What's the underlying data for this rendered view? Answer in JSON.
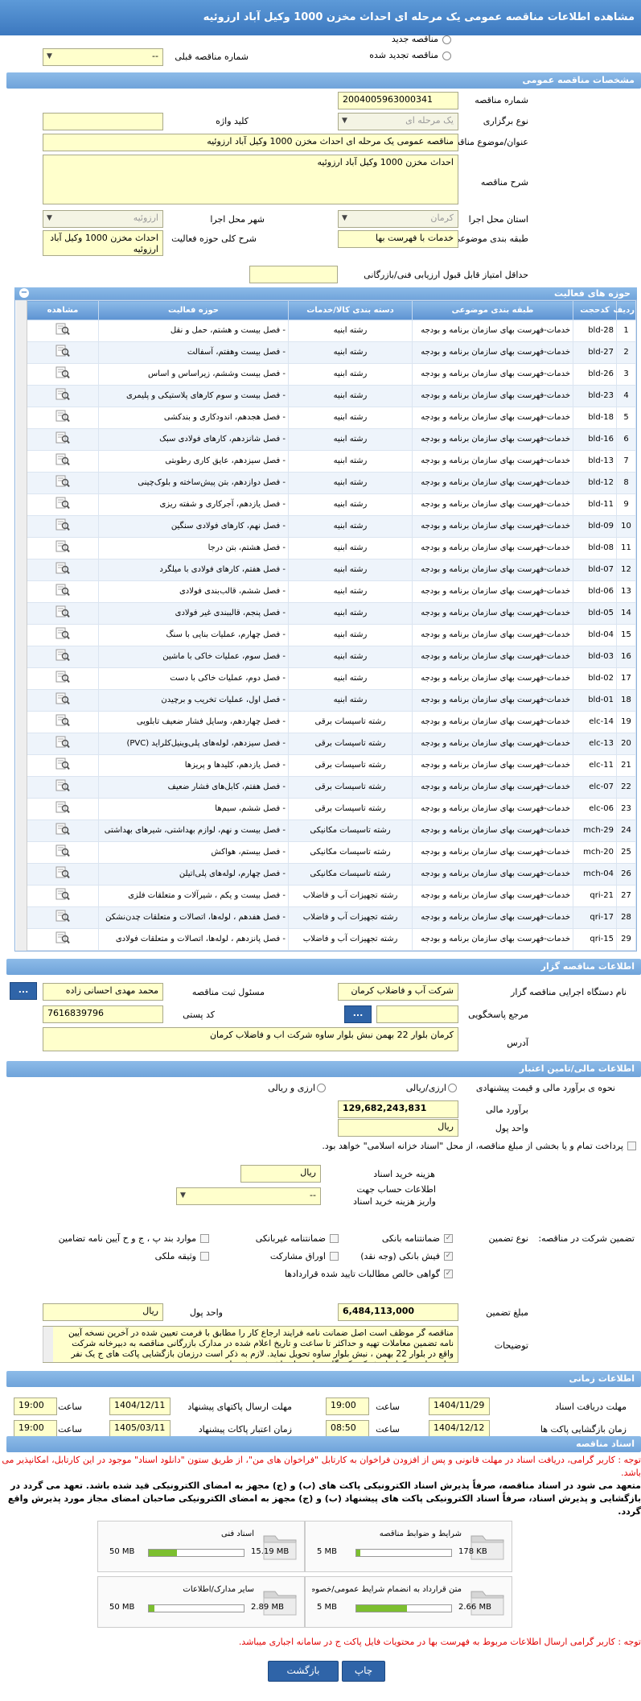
{
  "title": "مشاهده اطلاعات مناقصه عمومی یک مرحله ای احداث مخزن 1000 وکیل آباد ارزوئیه",
  "top": {
    "radio_new": "مناقصه جدید",
    "radio_renewed": "مناقصه تجدید شده",
    "prev_number_label": "شماره مناقصه قبلی",
    "prev_number_value": "--"
  },
  "general": {
    "section": "مشخصات مناقصه عمومی",
    "number_label": "شماره مناقصه",
    "number_value": "2004005963000341",
    "type_label": "نوع برگزاری",
    "type_value": "یک مرحله ای",
    "keyword_label": "کلید واژه",
    "keyword_value": "",
    "subject_label": "عنوان/موضوع مناقصه",
    "subject_value": "مناقصه عمومی یک مرحله ای احداث مخزن 1000 وکیل آباد ارزوئیه",
    "desc_label": "شرح مناقصه",
    "desc_value": "احداث مخزن 1000 وکیل آباد ارزوئیه",
    "province_label": "استان محل اجرا",
    "province_value": "کرمان",
    "city_label": "شهر محل اجرا",
    "city_value": "ارزوئیه",
    "category_label": "طبقه بندی موضوعی",
    "category_value": "خدمات با فهرست بها",
    "scope_label": "شرح کلی حوزه فعالیت",
    "scope_value": "احداث مخزن 1000 وکیل آباد ارزوئیه",
    "min_score_label": "حداقل امتیاز قابل قبول ارزیابی فنی/بازرگانی",
    "min_score_value": ""
  },
  "activities": {
    "section": "حوزه های فعالیت",
    "columns": [
      "ردیف",
      "کدحجت",
      "طبقه بندی موضوعی",
      "دسته بندی کالا/خدمات",
      "حوزه فعالیت",
      "مشاهده"
    ],
    "rows": [
      {
        "n": "1",
        "code": "bld-28",
        "cat": "خدمات-فهرست بهای سازمان برنامه و بودجه",
        "group": "رشته ابنیه",
        "field": "- فصل بیست و هشتم، حمل و نقل"
      },
      {
        "n": "2",
        "code": "bld-27",
        "cat": "خدمات-فهرست بهای سازمان برنامه و بودجه",
        "group": "رشته ابنیه",
        "field": "- فصل بیست وهفتم، آسفالت"
      },
      {
        "n": "3",
        "code": "bld-26",
        "cat": "خدمات-فهرست بهای سازمان برنامه و بودجه",
        "group": "رشته ابنیه",
        "field": "- فصل بیست وششم، زیراساس و اساس"
      },
      {
        "n": "4",
        "code": "bld-23",
        "cat": "خدمات-فهرست بهای سازمان برنامه و بودجه",
        "group": "رشته ابنیه",
        "field": "- فصل بیست و سوم کارهای پلاستیکی و پلیمری"
      },
      {
        "n": "5",
        "code": "bld-18",
        "cat": "خدمات-فهرست بهای سازمان برنامه و بودجه",
        "group": "رشته ابنیه",
        "field": "- فصل هجدهم، اندودکاری و بندکشی"
      },
      {
        "n": "6",
        "code": "bld-16",
        "cat": "خدمات-فهرست بهای سازمان برنامه و بودجه",
        "group": "رشته ابنیه",
        "field": "- فصل شانزدهم، کارهای فولادی سبک"
      },
      {
        "n": "7",
        "code": "bld-13",
        "cat": "خدمات-فهرست بهای سازمان برنامه و بودجه",
        "group": "رشته ابنیه",
        "field": "- فصل سیزدهم، عایق کاری رطوبتی"
      },
      {
        "n": "8",
        "code": "bld-12",
        "cat": "خدمات-فهرست بهای سازمان برنامه و بودجه",
        "group": "رشته ابنیه",
        "field": "- فصل دوازدهم، بتن پیش‌ساخته و بلوک‌چینی"
      },
      {
        "n": "9",
        "code": "bld-11",
        "cat": "خدمات-فهرست بهای سازمان برنامه و بودجه",
        "group": "رشته ابنیه",
        "field": "- فصل یازدهم، آجرکاری و شفته ریزی"
      },
      {
        "n": "10",
        "code": "bld-09",
        "cat": "خدمات-فهرست بهای سازمان برنامه و بودجه",
        "group": "رشته ابنیه",
        "field": "- فصل نهم، کارهای فولادی سنگین"
      },
      {
        "n": "11",
        "code": "bld-08",
        "cat": "خدمات-فهرست بهای سازمان برنامه و بودجه",
        "group": "رشته ابنیه",
        "field": "- فصل هشتم، بتن درجا"
      },
      {
        "n": "12",
        "code": "bld-07",
        "cat": "خدمات-فهرست بهای سازمان برنامه و بودجه",
        "group": "رشته ابنیه",
        "field": "- فصل هفتم، کارهای فولادی با میلگرد"
      },
      {
        "n": "13",
        "code": "bld-06",
        "cat": "خدمات-فهرست بهای سازمان برنامه و بودجه",
        "group": "رشته ابنیه",
        "field": "- فصل ششم، قالب‌بندی فولادی"
      },
      {
        "n": "14",
        "code": "bld-05",
        "cat": "خدمات-فهرست بهای سازمان برنامه و بودجه",
        "group": "رشته ابنیه",
        "field": "- فصل پنجم، قالببندی غیر فولادی"
      },
      {
        "n": "15",
        "code": "bld-04",
        "cat": "خدمات-فهرست بهای سازمان برنامه و بودجه",
        "group": "رشته ابنیه",
        "field": "- فصل چهارم، عملیات بنایی با سنگ"
      },
      {
        "n": "16",
        "code": "bld-03",
        "cat": "خدمات-فهرست بهای سازمان برنامه و بودجه",
        "group": "رشته ابنیه",
        "field": "- فصل سوم، عملیات خاکی با ماشین"
      },
      {
        "n": "17",
        "code": "bld-02",
        "cat": "خدمات-فهرست بهای سازمان برنامه و بودجه",
        "group": "رشته ابنیه",
        "field": "- فصل دوم، عملیات خاکی با دست"
      },
      {
        "n": "18",
        "code": "bld-01",
        "cat": "خدمات-فهرست بهای سازمان برنامه و بودجه",
        "group": "رشته ابنیه",
        "field": "- فصل اول، عملیات تخریب و برچیدن"
      },
      {
        "n": "19",
        "code": "elc-14",
        "cat": "خدمات-فهرست بهای سازمان برنامه و بودجه",
        "group": "رشته تاسیسات برقی",
        "field": "- فصل چهاردهم، وسایل فشار ضعیف تابلویی"
      },
      {
        "n": "20",
        "code": "elc-13",
        "cat": "خدمات-فهرست بهای سازمان برنامه و بودجه",
        "group": "رشته تاسیسات برقی",
        "field": "- فصل سیزدهم، لوله‌های پلی‌وینیل‌کلراید (PVC)"
      },
      {
        "n": "21",
        "code": "elc-11",
        "cat": "خدمات-فهرست بهای سازمان برنامه و بودجه",
        "group": "رشته تاسیسات برقی",
        "field": "- فصل یازدهم، کلیدها و پریزها"
      },
      {
        "n": "22",
        "code": "elc-07",
        "cat": "خدمات-فهرست بهای سازمان برنامه و بودجه",
        "group": "رشته تاسیسات برقی",
        "field": "- فصل هفتم، کابل‌های فشار ضعیف"
      },
      {
        "n": "23",
        "code": "elc-06",
        "cat": "خدمات-فهرست بهای سازمان برنامه و بودجه",
        "group": "رشته تاسیسات برقی",
        "field": "- فصل ششم، سیم‌ها"
      },
      {
        "n": "24",
        "code": "mch-29",
        "cat": "خدمات-فهرست بهای سازمان برنامه و بودجه",
        "group": "رشته تاسیسات مکانیکی",
        "field": "- فصل بیست و نهم، لوازم بهداشتی، شیرهای بهداشتی"
      },
      {
        "n": "25",
        "code": "mch-20",
        "cat": "خدمات-فهرست بهای سازمان برنامه و بودجه",
        "group": "رشته تاسیسات مکانیکی",
        "field": "- فصل بیستم، هواکش"
      },
      {
        "n": "26",
        "code": "mch-04",
        "cat": "خدمات-فهرست بهای سازمان برنامه و بودجه",
        "group": "رشته تاسیسات مکانیکی",
        "field": "- فصل چهارم، لوله‌های پلی‌اتیلن"
      },
      {
        "n": "27",
        "code": "qri-21",
        "cat": "خدمات-فهرست بهای سازمان برنامه و بودجه",
        "group": "رشته تجهیزات آب و فاضلاب",
        "field": "- فصل بیست و یکم ، شیرآلات و متعلقات فلزی"
      },
      {
        "n": "28",
        "code": "qri-17",
        "cat": "خدمات-فهرست بهای سازمان برنامه و بودجه",
        "group": "رشته تجهیزات آب و فاضلاب",
        "field": "- فصل هفدهم ، لوله‌ها، اتصالات و متعلقات چدن‌نشکن"
      },
      {
        "n": "29",
        "code": "qri-15",
        "cat": "خدمات-فهرست بهای سازمان برنامه و بودجه",
        "group": "رشته تجهیزات آب و فاضلاب",
        "field": "- فصل پانزدهم ، لوله‌ها، اتصالات و متعلقات فولادی"
      }
    ]
  },
  "organizer": {
    "section": "اطلاعات مناقصه گزار",
    "org_label": "نام دستگاه اجرایی مناقصه گزار",
    "org_value": "شرکت آب و فاضلاب کرمان",
    "resp_label": "مسئول ثبت مناقصه",
    "resp_value": "محمد مهدی احسانی زاده",
    "btn_dots": "...",
    "ref_label": "مرجع پاسخگویی",
    "ref_value": "",
    "postal_label": "کد پستی",
    "postal_value": "7616839796",
    "address_label": "آدرس",
    "address_value": "کرمان بلوار 22 بهمن نبش بلوار ساوه شرکت اب و فاضلاب کرمان"
  },
  "financial": {
    "section": "اطلاعات مالی/تامین اعتبار",
    "estimate_label": "نحوه ی برآورد مالی و قیمت پیشنهادی",
    "opt_rial_fx": "ارزی/ریالی",
    "opt_fx_and_rial": "ارزی و ریالی",
    "budget_label": "برآورد مالی",
    "budget_value": "129,682,243,831",
    "currency_label": "واحد پول",
    "currency_value": "ریال",
    "treasury_text": "پرداخت تمام و یا بخشی از مبلغ مناقصه، از محل \"اسناد خزانه اسلامی\" خواهد بود.",
    "purchase_cost_label": "هزینه خرید اسناد",
    "purchase_cost_value": "ریال",
    "account_label": "اطلاعات حساب جهت واریز هزینه خرید اسناد",
    "account_value": "--",
    "guarantee_type_label": "تضمین شرکت در مناقصه:",
    "guarantee_kind_label": "نوع تضمین",
    "g_bank": "ضمانتنامه بانکی",
    "g_nonbank": "ضمانتنامه غیربانکی",
    "g_other": "موارد بند پ ، ج و ح آیین نامه تضامین",
    "g_receipt": "فیش بانکی (وجه نقد)",
    "g_bonds": "اوراق مشارکت",
    "g_property": "وثیقه ملکی",
    "g_claims": "گواهی خالص مطالبات تایید شده قراردادها",
    "amount_label": "مبلغ تضمین",
    "amount_value": "6,484,113,000",
    "amount_currency_label": "واحد پول",
    "amount_currency_value": "ریال",
    "notes_label": "توضیحات",
    "notes_value": "مناقصه گر موظف است اصل ضمانت نامه فرایند ارجاع کار را مطابق با فرمت تعیین شده در آخرین نسخه آیین نامه تضمین معاملات تهیه و حداکثر تا ساعت و تاریخ اعلام شده در مدارک بازرگانی مناقصه به دبیرخانه شرکت واقع در بلوار 22 بهمن ، نبش بلوار ساوه تحویل نماید. لازم به ذکر است درزمان بازگشایی پاکت های ج یک نفر نماینده از هر کدام از شرکت کنندگان ، با همراه داشتن معرفی نامه"
  },
  "timing": {
    "section": "اطلاعات زمانی",
    "receive_deadline_label": "مهلت دریافت اسناد",
    "receive_deadline_date": "1404/11/29",
    "receive_deadline_time": "19:00",
    "send_deadline_label": "مهلت ارسال پاکتهای پیشنهاد",
    "send_deadline_date": "1404/12/11",
    "send_deadline_time": "19:00",
    "opening_label": "زمان بازگشایی پاکت ها",
    "opening_date": "1404/12/12",
    "opening_time": "08:50",
    "validity_label": "زمان اعتبار پاکات پیشنهاد",
    "validity_date": "1405/03/11",
    "validity_time": "19:00",
    "time_label": "ساعت"
  },
  "documents": {
    "section": "اسناد مناقصه",
    "notice_red": "توجه : کاربر گرامی، دریافت اسناد در مهلت قانونی و پس از افزودن فراخوان به کارتابل \"فراخوان های من\"، از طریق ستون \"دانلود اسناد\" موجود در این کارتابل، امکانپذیر می باشد.",
    "notice_bold": "متعهد می شود در اسناد مناقصه، صرفاً پذیرش اسناد الکترونیکی پاکت های (ب) و (ج) مجهز به امضای الکترونیکی قید شده باشد. تعهد می گردد در بازگشایی و پذیرش اسناد، صرفاً اسناد الکترونیکی پاکت های پیشنهاد (ب) و (ج) مجهز به امضای الکترونیکی صاحبان امضای مجاز مورد پذیرش واقع گردد.",
    "files": [
      {
        "name": "شرایط و ضوابط مناقصه",
        "size": "178 KB",
        "max": "5 MB",
        "fill": 0.04
      },
      {
        "name": "اسناد فنی",
        "size": "15.19 MB",
        "max": "50 MB",
        "fill": 0.3
      },
      {
        "name": "متن قرارداد به انضمام شرایط عمومی/خصوصی",
        "size": "2.66 MB",
        "max": "5 MB",
        "fill": 0.53
      },
      {
        "name": "سایر مدارک/اطلاعات",
        "size": "2.89 MB",
        "max": "50 MB",
        "fill": 0.06
      }
    ],
    "notice_bottom": "توجه : کاربر گرامی ارسال اطلاعات مربوط به فهرست بها در محتویات فایل پاکت ج در سامانه اجباری میباشد."
  },
  "buttons": {
    "print": "چاپ",
    "back": "بازگشت"
  }
}
